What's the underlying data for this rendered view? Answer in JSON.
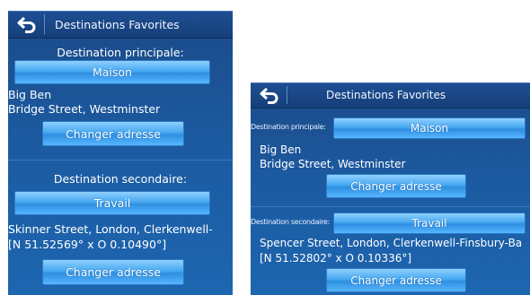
{
  "left": {
    "title": "Destinations Favorites",
    "primary": {
      "heading": "Destination principale:",
      "button": "Maison",
      "address_line1": "Big Ben",
      "address_line2": "Bridge Street, Westminster",
      "change": "Changer adresse"
    },
    "secondary": {
      "heading": "Destination secondaire:",
      "button": "Travail",
      "address_line1": "Skinner Street, London, Clerkenwell-",
      "address_line2": "[N 51.52569° x O 0.10490°]",
      "change": "Changer adresse"
    }
  },
  "right": {
    "title": "Destinations Favorites",
    "primary": {
      "label": "Destination principale:",
      "button": "Maison",
      "address_line1": "Big Ben",
      "address_line2": "Bridge Street, Westminster",
      "change": "Changer adresse"
    },
    "secondary": {
      "label": "Destination secondaire:",
      "button": "Travail",
      "address_line1": "Spencer Street, London, Clerkenwell-Finsbury-Ba",
      "address_line2": "[N 51.52802° x O 0.10336°]",
      "change": "Changer adresse"
    }
  }
}
